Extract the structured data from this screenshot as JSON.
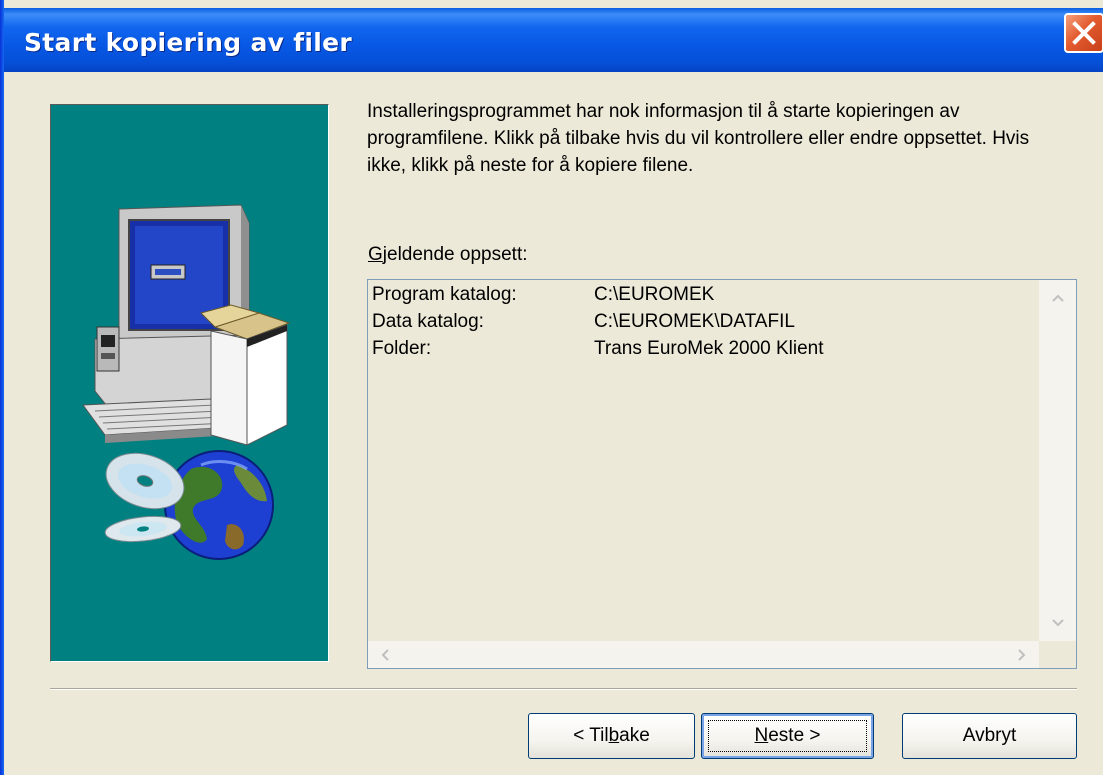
{
  "window": {
    "title": "Start kopiering av filer"
  },
  "intro_text": "Installeringsprogrammet har nok informasjon til å starte kopieringen av programfilene. Klikk på tilbake hvis du vil kontrollere eller endre oppsettet. Hvis ikke, klikk på neste for å kopiere filene.",
  "current_setup": {
    "label_prefix": "G",
    "label_rest": "jeldende oppsett:",
    "rows": [
      {
        "key": "Program katalog:",
        "value": "C:\\EUROMEK"
      },
      {
        "key": "Data katalog:",
        "value": "C:\\EUROMEK\\DATAFIL"
      },
      {
        "key": "Folder:",
        "value": "Trans EuroMek 2000 Klient"
      }
    ]
  },
  "buttons": {
    "back": {
      "arrow": "<",
      "pre": " Til",
      "accel": "b",
      "post": "ake"
    },
    "next": {
      "accel": "N",
      "post": "este",
      "arrow": " >"
    },
    "cancel": "Avbryt"
  },
  "colors": {
    "banner_bg": "#008080",
    "titlebar": "#0757e4",
    "close_button": "#e35b2e",
    "dialog_bg": "#ece9d8"
  },
  "icons": {
    "close": "close-x-icon",
    "computer": "computer-illustration",
    "globe": "globe-illustration",
    "cd": "cd-disc-illustration"
  }
}
